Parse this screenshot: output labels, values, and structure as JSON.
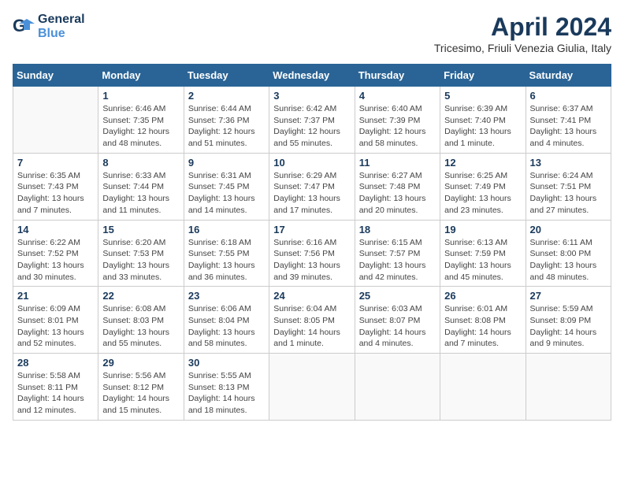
{
  "header": {
    "logo_line1": "General",
    "logo_line2": "Blue",
    "month_title": "April 2024",
    "location": "Tricesimo, Friuli Venezia Giulia, Italy"
  },
  "days_of_week": [
    "Sunday",
    "Monday",
    "Tuesday",
    "Wednesday",
    "Thursday",
    "Friday",
    "Saturday"
  ],
  "weeks": [
    [
      {
        "day": "",
        "info": ""
      },
      {
        "day": "1",
        "info": "Sunrise: 6:46 AM\nSunset: 7:35 PM\nDaylight: 12 hours\nand 48 minutes."
      },
      {
        "day": "2",
        "info": "Sunrise: 6:44 AM\nSunset: 7:36 PM\nDaylight: 12 hours\nand 51 minutes."
      },
      {
        "day": "3",
        "info": "Sunrise: 6:42 AM\nSunset: 7:37 PM\nDaylight: 12 hours\nand 55 minutes."
      },
      {
        "day": "4",
        "info": "Sunrise: 6:40 AM\nSunset: 7:39 PM\nDaylight: 12 hours\nand 58 minutes."
      },
      {
        "day": "5",
        "info": "Sunrise: 6:39 AM\nSunset: 7:40 PM\nDaylight: 13 hours\nand 1 minute."
      },
      {
        "day": "6",
        "info": "Sunrise: 6:37 AM\nSunset: 7:41 PM\nDaylight: 13 hours\nand 4 minutes."
      }
    ],
    [
      {
        "day": "7",
        "info": "Sunrise: 6:35 AM\nSunset: 7:43 PM\nDaylight: 13 hours\nand 7 minutes."
      },
      {
        "day": "8",
        "info": "Sunrise: 6:33 AM\nSunset: 7:44 PM\nDaylight: 13 hours\nand 11 minutes."
      },
      {
        "day": "9",
        "info": "Sunrise: 6:31 AM\nSunset: 7:45 PM\nDaylight: 13 hours\nand 14 minutes."
      },
      {
        "day": "10",
        "info": "Sunrise: 6:29 AM\nSunset: 7:47 PM\nDaylight: 13 hours\nand 17 minutes."
      },
      {
        "day": "11",
        "info": "Sunrise: 6:27 AM\nSunset: 7:48 PM\nDaylight: 13 hours\nand 20 minutes."
      },
      {
        "day": "12",
        "info": "Sunrise: 6:25 AM\nSunset: 7:49 PM\nDaylight: 13 hours\nand 23 minutes."
      },
      {
        "day": "13",
        "info": "Sunrise: 6:24 AM\nSunset: 7:51 PM\nDaylight: 13 hours\nand 27 minutes."
      }
    ],
    [
      {
        "day": "14",
        "info": "Sunrise: 6:22 AM\nSunset: 7:52 PM\nDaylight: 13 hours\nand 30 minutes."
      },
      {
        "day": "15",
        "info": "Sunrise: 6:20 AM\nSunset: 7:53 PM\nDaylight: 13 hours\nand 33 minutes."
      },
      {
        "day": "16",
        "info": "Sunrise: 6:18 AM\nSunset: 7:55 PM\nDaylight: 13 hours\nand 36 minutes."
      },
      {
        "day": "17",
        "info": "Sunrise: 6:16 AM\nSunset: 7:56 PM\nDaylight: 13 hours\nand 39 minutes."
      },
      {
        "day": "18",
        "info": "Sunrise: 6:15 AM\nSunset: 7:57 PM\nDaylight: 13 hours\nand 42 minutes."
      },
      {
        "day": "19",
        "info": "Sunrise: 6:13 AM\nSunset: 7:59 PM\nDaylight: 13 hours\nand 45 minutes."
      },
      {
        "day": "20",
        "info": "Sunrise: 6:11 AM\nSunset: 8:00 PM\nDaylight: 13 hours\nand 48 minutes."
      }
    ],
    [
      {
        "day": "21",
        "info": "Sunrise: 6:09 AM\nSunset: 8:01 PM\nDaylight: 13 hours\nand 52 minutes."
      },
      {
        "day": "22",
        "info": "Sunrise: 6:08 AM\nSunset: 8:03 PM\nDaylight: 13 hours\nand 55 minutes."
      },
      {
        "day": "23",
        "info": "Sunrise: 6:06 AM\nSunset: 8:04 PM\nDaylight: 13 hours\nand 58 minutes."
      },
      {
        "day": "24",
        "info": "Sunrise: 6:04 AM\nSunset: 8:05 PM\nDaylight: 14 hours\nand 1 minute."
      },
      {
        "day": "25",
        "info": "Sunrise: 6:03 AM\nSunset: 8:07 PM\nDaylight: 14 hours\nand 4 minutes."
      },
      {
        "day": "26",
        "info": "Sunrise: 6:01 AM\nSunset: 8:08 PM\nDaylight: 14 hours\nand 7 minutes."
      },
      {
        "day": "27",
        "info": "Sunrise: 5:59 AM\nSunset: 8:09 PM\nDaylight: 14 hours\nand 9 minutes."
      }
    ],
    [
      {
        "day": "28",
        "info": "Sunrise: 5:58 AM\nSunset: 8:11 PM\nDaylight: 14 hours\nand 12 minutes."
      },
      {
        "day": "29",
        "info": "Sunrise: 5:56 AM\nSunset: 8:12 PM\nDaylight: 14 hours\nand 15 minutes."
      },
      {
        "day": "30",
        "info": "Sunrise: 5:55 AM\nSunset: 8:13 PM\nDaylight: 14 hours\nand 18 minutes."
      },
      {
        "day": "",
        "info": ""
      },
      {
        "day": "",
        "info": ""
      },
      {
        "day": "",
        "info": ""
      },
      {
        "day": "",
        "info": ""
      }
    ]
  ]
}
